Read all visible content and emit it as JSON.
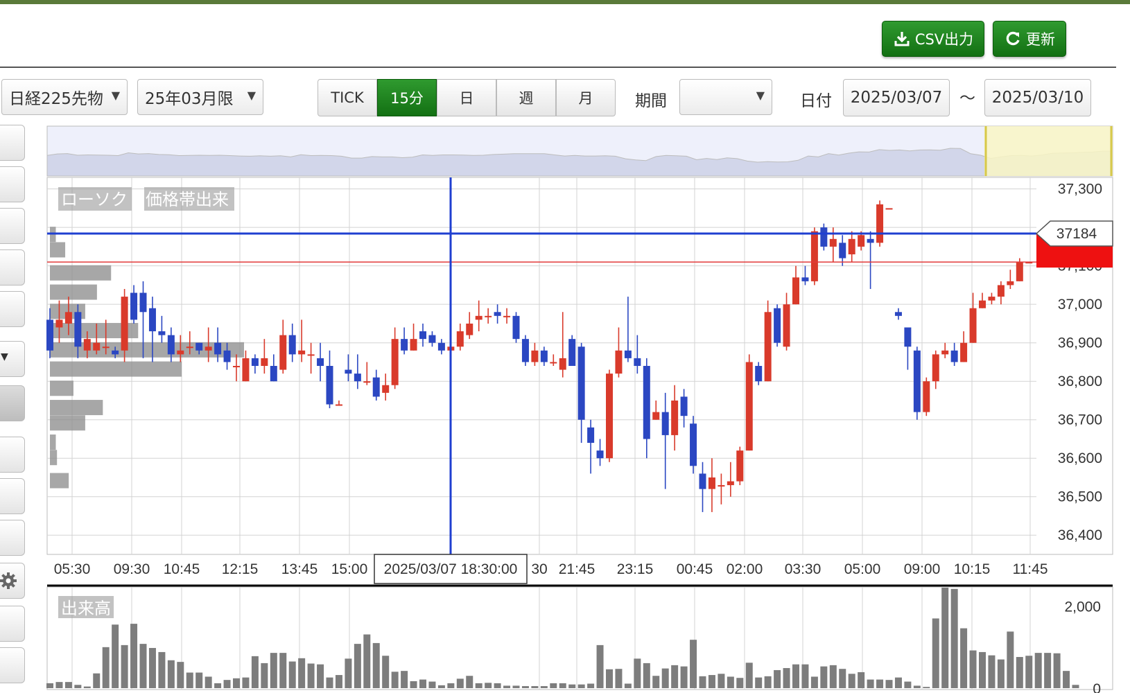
{
  "toolbar": {
    "csv_label": "CSV出力",
    "refresh_label": "更新"
  },
  "filters": {
    "instrument": "日経225先物",
    "contract": "25年03月限",
    "period_label": "期間",
    "period_value": "",
    "date_label": "日付",
    "date_from": "2025/03/07",
    "date_sep": "～",
    "date_to": "2025/03/10"
  },
  "intervals": [
    "TICK",
    "15分",
    "日",
    "週",
    "月"
  ],
  "active_interval": "15分",
  "legend": {
    "candle": "ローソク",
    "volume_profile": "価格帯出来"
  },
  "volume_label": "出来高",
  "crosshair_time": "2025/03/07 18:30:00",
  "price_marker": "37184",
  "colors": {
    "up": "#d93a2b",
    "down": "#2b47c2",
    "active": "#1e8a1e",
    "crosshair": "#1f3fd0",
    "marker_red": "#ee1111"
  },
  "chart_data": {
    "type": "candlestick",
    "price_axis": {
      "ticks": [
        "37,300",
        "37,200",
        "37,100",
        "37,000",
        "36,900",
        "36,800",
        "36,700",
        "36,600",
        "36,500",
        "36,400"
      ],
      "range": [
        36350,
        37330
      ]
    },
    "time_labels": [
      "05:30",
      "09:30",
      "10:45",
      "12:15",
      "13:45",
      "15:00",
      "30",
      "21:45",
      "23:15",
      "00:45",
      "02:00",
      "03:30",
      "05:00",
      "09:00",
      "10:15",
      "11:45"
    ],
    "current_price": 37184,
    "last_price_line": 37110,
    "candles": [
      [
        36960,
        36880,
        36990,
        36860
      ],
      [
        36940,
        36960,
        37010,
        36900
      ],
      [
        36950,
        36980,
        37020,
        36920
      ],
      [
        36980,
        36890,
        37000,
        36860
      ],
      [
        36880,
        36910,
        36930,
        36860
      ],
      [
        36880,
        36900,
        36950,
        36870
      ],
      [
        36890,
        36890,
        36960,
        36870
      ],
      [
        36880,
        36870,
        36890,
        36860
      ],
      [
        36880,
        37020,
        37040,
        36850
      ],
      [
        37030,
        36960,
        37050,
        36950
      ],
      [
        37030,
        36980,
        37060,
        36860
      ],
      [
        36990,
        36930,
        37020,
        36850
      ],
      [
        36930,
        36920,
        36970,
        36900
      ],
      [
        36920,
        36870,
        36940,
        36850
      ],
      [
        36870,
        36880,
        36920,
        36850
      ],
      [
        36890,
        36890,
        36930,
        36870
      ],
      [
        36900,
        36880,
        36900,
        36870
      ],
      [
        36880,
        36890,
        36940,
        36850
      ],
      [
        36900,
        36870,
        36940,
        36850
      ],
      [
        36880,
        36850,
        36900,
        36830
      ],
      [
        36840,
        36840,
        36870,
        36800
      ],
      [
        36800,
        36860,
        36880,
        36800
      ],
      [
        36860,
        36840,
        36870,
        36820
      ],
      [
        36840,
        36860,
        36910,
        36820
      ],
      [
        36840,
        36800,
        36870,
        36800
      ],
      [
        36830,
        36920,
        36960,
        36820
      ],
      [
        36920,
        36870,
        36950,
        36850
      ],
      [
        36870,
        36880,
        36960,
        36850
      ],
      [
        36870,
        36870,
        36900,
        36820
      ],
      [
        36860,
        36840,
        36900,
        36800
      ],
      [
        36840,
        36740,
        36880,
        36730
      ],
      [
        36740,
        36740,
        36750,
        36740
      ],
      [
        36830,
        36820,
        36870,
        36800
      ],
      [
        36820,
        36800,
        36870,
        36780
      ],
      [
        36800,
        36800,
        36850,
        36790
      ],
      [
        36810,
        36760,
        36830,
        36750
      ],
      [
        36770,
        36790,
        36820,
        36750
      ],
      [
        36790,
        36910,
        36940,
        36780
      ],
      [
        36910,
        36880,
        36940,
        36870
      ],
      [
        36880,
        36910,
        36950,
        36880
      ],
      [
        36930,
        36910,
        36950,
        36890
      ],
      [
        36920,
        36900,
        36930,
        36890
      ],
      [
        36900,
        36880,
        36910,
        36870
      ],
      [
        36880,
        36890,
        36920,
        36870
      ],
      [
        36890,
        36930,
        36950,
        36880
      ],
      [
        36920,
        36950,
        36980,
        36910
      ],
      [
        36960,
        36970,
        37010,
        36930
      ],
      [
        36970,
        36970,
        36990,
        36950
      ],
      [
        36980,
        36970,
        37000,
        36950
      ],
      [
        36970,
        36970,
        36990,
        36950
      ],
      [
        36970,
        36910,
        36980,
        36900
      ],
      [
        36910,
        36850,
        36920,
        36840
      ],
      [
        36850,
        36880,
        36900,
        36840
      ],
      [
        36880,
        36850,
        36890,
        36840
      ],
      [
        36850,
        36850,
        36870,
        36840
      ],
      [
        36830,
        36860,
        36980,
        36810
      ],
      [
        36910,
        36840,
        36920,
        36840
      ],
      [
        36890,
        36700,
        36900,
        36640
      ],
      [
        36680,
        36640,
        36700,
        36560
      ],
      [
        36620,
        36600,
        36650,
        36580
      ],
      [
        36600,
        36820,
        36830,
        36590
      ],
      [
        36820,
        36880,
        36940,
        36810
      ],
      [
        36880,
        36860,
        37020,
        36850
      ],
      [
        36860,
        36840,
        36920,
        36820
      ],
      [
        36840,
        36650,
        36860,
        36600
      ],
      [
        36700,
        36720,
        36750,
        36700
      ],
      [
        36720,
        36660,
        36770,
        36520
      ],
      [
        36660,
        36750,
        36790,
        36620
      ],
      [
        36760,
        36710,
        36780,
        36680
      ],
      [
        36690,
        36580,
        36710,
        36560
      ],
      [
        36560,
        36520,
        36590,
        36460
      ],
      [
        36520,
        36550,
        36600,
        36460
      ],
      [
        36530,
        36530,
        36560,
        36480
      ],
      [
        36530,
        36540,
        36590,
        36500
      ],
      [
        36540,
        36620,
        36630,
        36530
      ],
      [
        36620,
        36850,
        36870,
        36620
      ],
      [
        36840,
        36800,
        36850,
        36790
      ],
      [
        36800,
        36980,
        37010,
        36800
      ],
      [
        36990,
        36900,
        37000,
        36890
      ],
      [
        36890,
        37000,
        37030,
        36880
      ],
      [
        37000,
        37070,
        37100,
        37000
      ],
      [
        37070,
        37060,
        37100,
        37050
      ],
      [
        37060,
        37190,
        37200,
        37050
      ],
      [
        37200,
        37150,
        37210,
        37140
      ],
      [
        37150,
        37170,
        37200,
        37110
      ],
      [
        37160,
        37120,
        37180,
        37100
      ],
      [
        37130,
        37170,
        37190,
        37110
      ],
      [
        37150,
        37180,
        37190,
        37140
      ],
      [
        37170,
        37160,
        37190,
        37040
      ],
      [
        37160,
        37260,
        37270,
        37150
      ],
      [
        37250,
        37250,
        37250,
        37250
      ],
      [
        36980,
        36970,
        36990,
        36960
      ],
      [
        36940,
        36890,
        36940,
        36830
      ],
      [
        36880,
        36720,
        36890,
        36700
      ],
      [
        36720,
        36800,
        36810,
        36710
      ],
      [
        36800,
        36870,
        36880,
        36780
      ],
      [
        36870,
        36880,
        36900,
        36860
      ],
      [
        36880,
        36850,
        36900,
        36840
      ],
      [
        36850,
        36900,
        36930,
        36850
      ],
      [
        36900,
        36990,
        37030,
        36900
      ],
      [
        36990,
        37010,
        37030,
        36990
      ],
      [
        37010,
        37020,
        37030,
        37000
      ],
      [
        37020,
        37050,
        37060,
        37000
      ],
      [
        37050,
        37060,
        37090,
        37040
      ],
      [
        37060,
        37110,
        37120,
        37060
      ],
      [
        37110,
        37110,
        37110,
        37110
      ]
    ],
    "volume_axis": {
      "ticks": [
        "2,000",
        "0"
      ],
      "range": [
        0,
        2400
      ]
    },
    "volumes": [
      120,
      150,
      150,
      80,
      40,
      360,
      1000,
      1550,
      1050,
      1570,
      1080,
      980,
      880,
      680,
      640,
      380,
      380,
      280,
      120,
      200,
      240,
      260,
      780,
      610,
      860,
      860,
      650,
      730,
      600,
      580,
      260,
      320,
      720,
      1080,
      1310,
      1100,
      790,
      400,
      420,
      170,
      210,
      160,
      70,
      120,
      230,
      300,
      120,
      130,
      120,
      60,
      60,
      50,
      50,
      50,
      120,
      120,
      90,
      90,
      110,
      1050,
      460,
      470,
      110,
      720,
      610,
      300,
      480,
      560,
      530,
      1180,
      290,
      320,
      350,
      280,
      250,
      620,
      260,
      290,
      440,
      490,
      580,
      580,
      280,
      530,
      560,
      470,
      350,
      390,
      210,
      210,
      200,
      260,
      160,
      60,
      30,
      1700,
      2450,
      2420,
      1460,
      920,
      880,
      800,
      700,
      1380,
      760,
      790,
      860,
      860,
      850,
      420,
      80
    ],
    "volume_profile": [
      {
        "price": 37180,
        "volume": 5
      },
      {
        "price": 37140,
        "volume": 13
      },
      {
        "price": 37080,
        "volume": 52
      },
      {
        "price": 37030,
        "volume": 40
      },
      {
        "price": 36980,
        "volume": 30
      },
      {
        "price": 36930,
        "volume": 75
      },
      {
        "price": 36880,
        "volume": 165
      },
      {
        "price": 36830,
        "volume": 112
      },
      {
        "price": 36780,
        "volume": 20
      },
      {
        "price": 36730,
        "volume": 45
      },
      {
        "price": 36690,
        "volume": 30
      },
      {
        "price": 36640,
        "volume": 5
      },
      {
        "price": 36600,
        "volume": 6
      },
      {
        "price": 36540,
        "volume": 16
      }
    ]
  }
}
